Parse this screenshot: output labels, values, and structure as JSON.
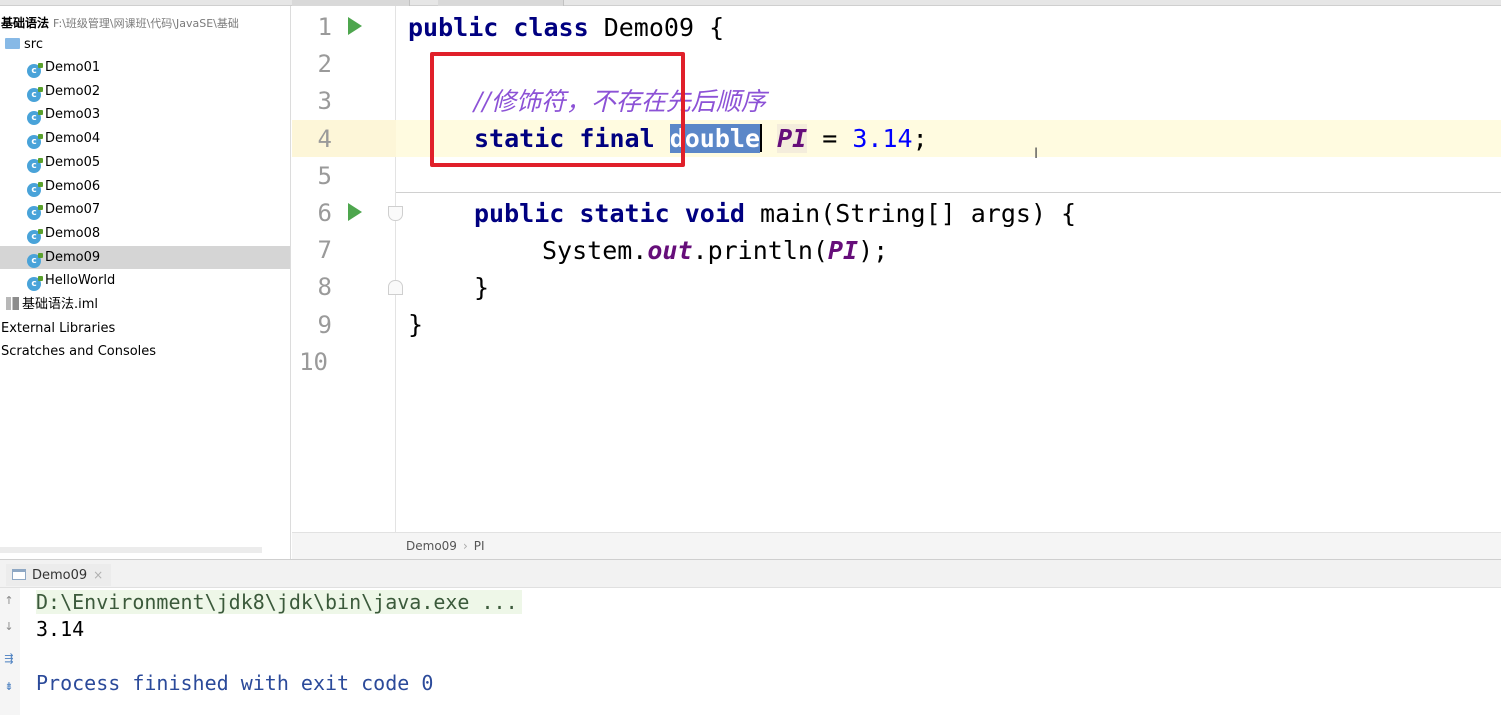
{
  "project": {
    "root_name": "基础语法",
    "root_path": "F:\\班级管理\\网课班\\代码\\JavaSE\\基础",
    "src_label": "src",
    "classes": [
      "Demo01",
      "Demo02",
      "Demo03",
      "Demo04",
      "Demo05",
      "Demo06",
      "Demo07",
      "Demo08",
      "Demo09",
      "HelloWorld"
    ],
    "selected_class": "Demo09",
    "iml_file": "基础语法.iml",
    "external_libraries": "External Libraries",
    "scratches": "Scratches and Consoles",
    "class_icon_glyph": "c"
  },
  "editor": {
    "line_numbers": [
      "1",
      "2",
      "3",
      "4",
      "5",
      "6",
      "7",
      "8",
      "9",
      "10"
    ],
    "code": {
      "l1_kw_public": "public",
      "l1_kw_class": "class",
      "l1_name": "Demo09",
      "l1_brace": "{",
      "l3_comment": "//修饰符，不存在先后顺序",
      "l4_kw_static": "static",
      "l4_kw_final": "final",
      "l4_type": "double",
      "l4_const": "PI",
      "l4_eq": "=",
      "l4_value": "3.14",
      "l4_semi": ";",
      "l6_kw_public": "public",
      "l6_kw_static": "static",
      "l6_kw_void": "void",
      "l6_sig": "main(String[] args) {",
      "l7_system": "System.",
      "l7_out": "out",
      "l7_call": ".println(",
      "l7_arg": "PI",
      "l7_end": ");",
      "l8_brace": "}",
      "l9_brace": "}"
    },
    "ibeam": "I",
    "breadcrumb": [
      "Demo09",
      "PI"
    ],
    "breadcrumb_sep": "›"
  },
  "run": {
    "tab_label": "Demo09",
    "tab_close": "×",
    "toolbar_icons": [
      "↑",
      "↓",
      "⇶",
      "⇟"
    ],
    "console": {
      "command": "D:\\Environment\\jdk8\\jdk\\bin\\java.exe ...",
      "output": "3.14",
      "exit_message": "Process finished with exit code 0"
    }
  },
  "colors": {
    "keyword": "#000080",
    "comment": "#8c52d6",
    "constant": "#660e7a",
    "number": "#0000ff",
    "selection": "#5b87c8",
    "annotation_box": "#e0202a",
    "run_icon": "#4ea64e"
  },
  "icons": {
    "run_gutter": "run-gutter-icon",
    "fold": "fold-icon",
    "folder": "folder-icon",
    "class": "java-class-icon",
    "iml": "iml-file-icon"
  }
}
